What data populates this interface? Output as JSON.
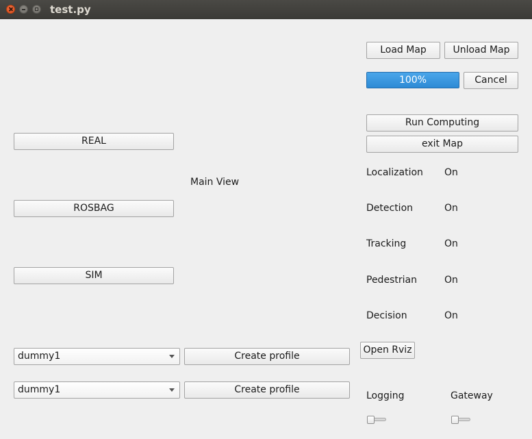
{
  "window": {
    "title": "test.py"
  },
  "map": {
    "load_label": "Load Map",
    "unload_label": "Unload Map",
    "progress_percent": 100,
    "progress_text": "100%",
    "cancel_label": "Cancel",
    "run_computing_label": "Run Computing",
    "exit_label": "exit Map"
  },
  "modes": {
    "real_label": "REAL",
    "rosbag_label": "ROSBAG",
    "sim_label": "SIM"
  },
  "main_view_label": "Main View",
  "status": [
    {
      "name": "Localization",
      "value": "On"
    },
    {
      "name": "Detection",
      "value": "On"
    },
    {
      "name": "Tracking",
      "value": "On"
    },
    {
      "name": "Pedestrian",
      "value": "On"
    },
    {
      "name": "Decision",
      "value": "On"
    }
  ],
  "rviz_label": "Open Rviz",
  "profiles": [
    {
      "selected": "dummy1",
      "button_label": "Create profile"
    },
    {
      "selected": "dummy1",
      "button_label": "Create profile"
    }
  ],
  "switches": {
    "logging_label": "Logging",
    "logging_on": false,
    "gateway_label": "Gateway",
    "gateway_on": false
  },
  "colors": {
    "progress_fill": "#3596df",
    "close_button": "#e95420"
  }
}
